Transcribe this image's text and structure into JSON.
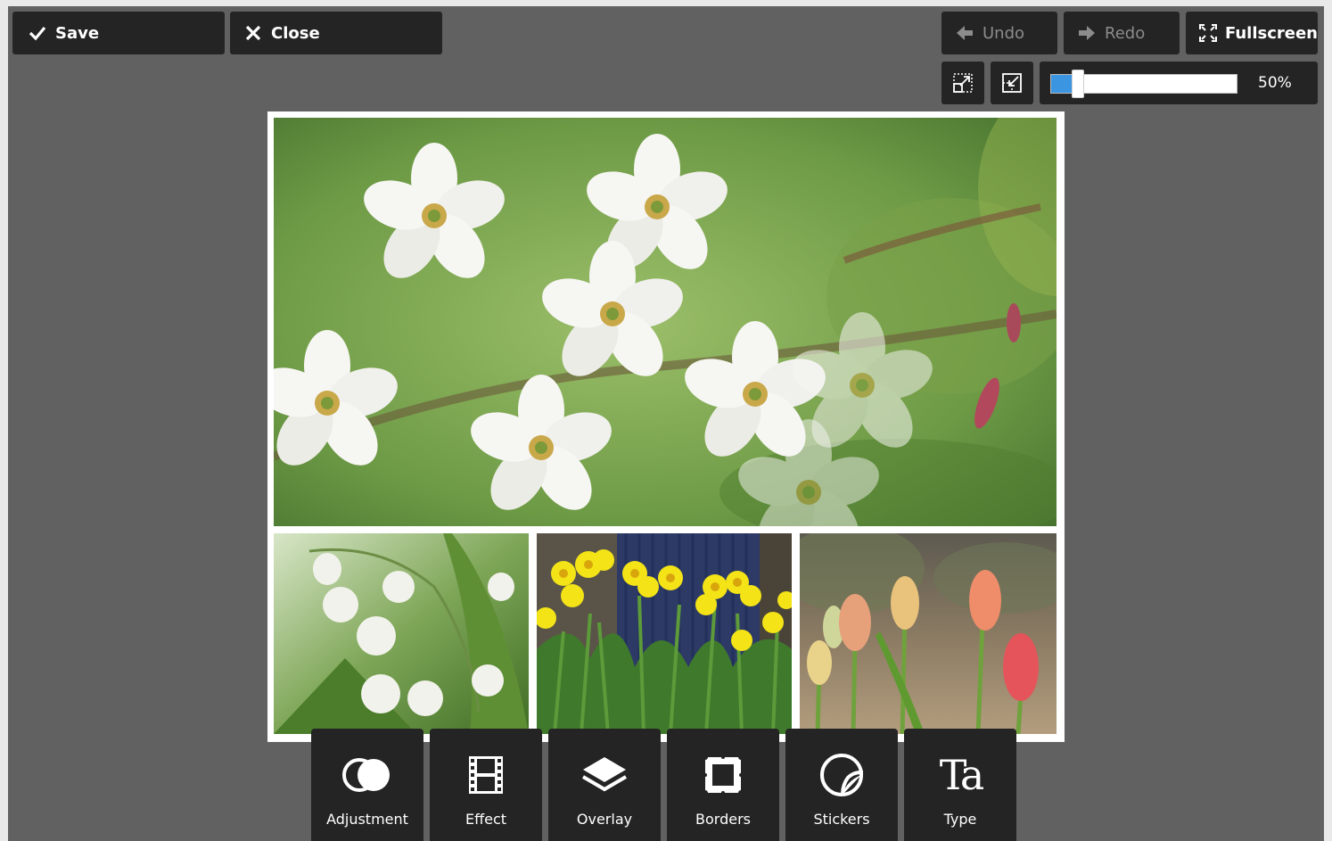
{
  "toolbar": {
    "save_label": "Save",
    "close_label": "Close",
    "undo_label": "Undo",
    "redo_label": "Redo",
    "fullscreen_label": "Fullscreen"
  },
  "zoom": {
    "value_label": "50%",
    "slider_fraction": 0.14
  },
  "collage": {
    "photos": [
      "blossom",
      "lily-of-the-valley",
      "daffodils",
      "tulips"
    ]
  },
  "tools": [
    {
      "label": "Adjustment",
      "icon": "adjustment-icon"
    },
    {
      "label": "Effect",
      "icon": "film-effect-icon"
    },
    {
      "label": "Overlay",
      "icon": "layers-overlay-icon"
    },
    {
      "label": "Borders",
      "icon": "borders-icon"
    },
    {
      "label": "Stickers",
      "icon": "sticker-icon"
    },
    {
      "label": "Type",
      "icon": "type-icon"
    }
  ],
  "type_icon_glyph": "Ta",
  "colors": {
    "workspace": "#616161",
    "button": "#242424",
    "accent": "#3c95e0",
    "disabled_text": "#8c8c8c"
  }
}
